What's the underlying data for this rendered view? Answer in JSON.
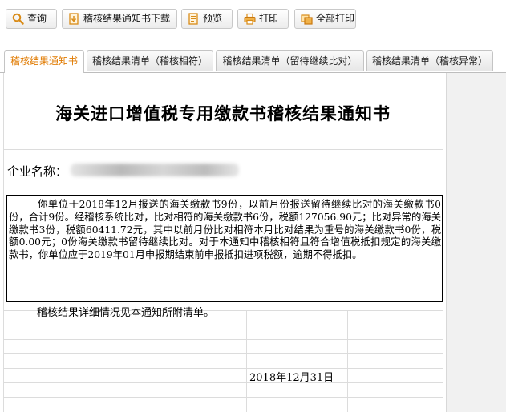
{
  "toolbar": {
    "query": "查询",
    "download": "稽核结果通知书下载",
    "preview": "预览",
    "print": "打印",
    "print_all": "全部打印"
  },
  "tabs": [
    {
      "label": "稽核结果通知书",
      "active": true
    },
    {
      "label": "稽核结果清单（稽核相符）",
      "active": false
    },
    {
      "label": "稽核结果清单（留待继续比对）",
      "active": false
    },
    {
      "label": "稽核结果清单（稽核异常）",
      "active": false
    }
  ],
  "document": {
    "title": "海关进口增值税专用缴款书稽核结果通知书",
    "company_label": "企业名称：",
    "body": "你单位于2018年12月报送的海关缴款书9份，以前月份报送留待继续比对的海关缴款书0份，合计9份。经稽核系统比对，比对相符的海关缴款书6份，税额127056.90元；比对异常的海关缴款书3份，税额60411.72元，其中以前月份比对相符本月比对结果为重号的海关缴款书0份，税额0.00元；0份海关缴款书留待继续比对。对于本通知中稽核相符且符合增值税抵扣规定的海关缴款书，你单位应于2019年01月申报期结束前申报抵扣进项税额，逾期不得抵扣。",
    "detail": "稽核结果详细情况见本通知所附清单。",
    "date": "2018年12月31日"
  },
  "colors": {
    "active_tab_text": "#e07a00",
    "toolbar_icon": "#e8a23a",
    "scroll_gutter": "#f1f1f1"
  }
}
